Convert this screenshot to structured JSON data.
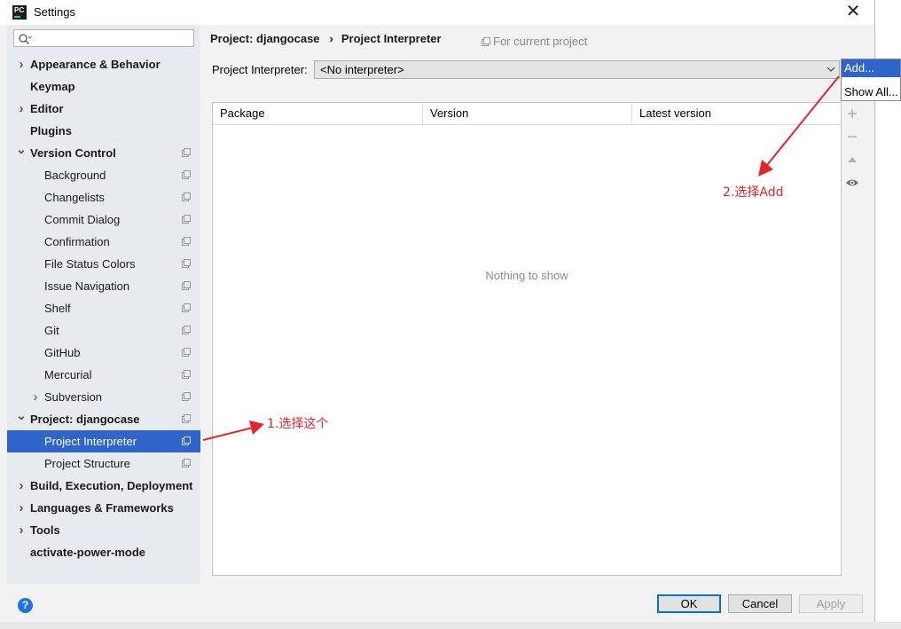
{
  "window": {
    "title": "Settings",
    "logo_text": "PC"
  },
  "search": {
    "placeholder": ""
  },
  "sidebar": {
    "items": [
      {
        "label": "Appearance & Behavior",
        "bold": true,
        "chevron": "right",
        "indent": 0,
        "project_icon": false
      },
      {
        "label": "Keymap",
        "bold": true,
        "chevron": "none",
        "indent": 0,
        "project_icon": false
      },
      {
        "label": "Editor",
        "bold": true,
        "chevron": "right",
        "indent": 0,
        "project_icon": false
      },
      {
        "label": "Plugins",
        "bold": true,
        "chevron": "none",
        "indent": 0,
        "project_icon": false
      },
      {
        "label": "Version Control",
        "bold": true,
        "chevron": "down",
        "indent": 0,
        "project_icon": true
      },
      {
        "label": "Background",
        "bold": false,
        "chevron": "none",
        "indent": 1,
        "project_icon": true
      },
      {
        "label": "Changelists",
        "bold": false,
        "chevron": "none",
        "indent": 1,
        "project_icon": true
      },
      {
        "label": "Commit Dialog",
        "bold": false,
        "chevron": "none",
        "indent": 1,
        "project_icon": true
      },
      {
        "label": "Confirmation",
        "bold": false,
        "chevron": "none",
        "indent": 1,
        "project_icon": true
      },
      {
        "label": "File Status Colors",
        "bold": false,
        "chevron": "none",
        "indent": 1,
        "project_icon": true
      },
      {
        "label": "Issue Navigation",
        "bold": false,
        "chevron": "none",
        "indent": 1,
        "project_icon": true
      },
      {
        "label": "Shelf",
        "bold": false,
        "chevron": "none",
        "indent": 1,
        "project_icon": true
      },
      {
        "label": "Git",
        "bold": false,
        "chevron": "none",
        "indent": 1,
        "project_icon": true
      },
      {
        "label": "GitHub",
        "bold": false,
        "chevron": "none",
        "indent": 1,
        "project_icon": true
      },
      {
        "label": "Mercurial",
        "bold": false,
        "chevron": "none",
        "indent": 1,
        "project_icon": true
      },
      {
        "label": "Subversion",
        "bold": false,
        "chevron": "right",
        "indent": 1,
        "project_icon": true
      },
      {
        "label": "Project: djangocase",
        "bold": true,
        "chevron": "down",
        "indent": 0,
        "project_icon": true
      },
      {
        "label": "Project Interpreter",
        "bold": false,
        "chevron": "none",
        "indent": 1,
        "project_icon": true,
        "selected": true
      },
      {
        "label": "Project Structure",
        "bold": false,
        "chevron": "none",
        "indent": 1,
        "project_icon": true
      },
      {
        "label": "Build, Execution, Deployment",
        "bold": true,
        "chevron": "right",
        "indent": 0,
        "project_icon": false
      },
      {
        "label": "Languages & Frameworks",
        "bold": true,
        "chevron": "right",
        "indent": 0,
        "project_icon": false
      },
      {
        "label": "Tools",
        "bold": true,
        "chevron": "right",
        "indent": 0,
        "project_icon": false
      },
      {
        "label": "activate-power-mode",
        "bold": true,
        "chevron": "none",
        "indent": 0,
        "project_icon": false
      }
    ]
  },
  "breadcrumb": {
    "project": "Project: djangocase",
    "separator": "›",
    "page": "Project Interpreter"
  },
  "for_current_project": "For current project",
  "interpreter": {
    "label": "Project Interpreter:",
    "value": "<No interpreter>"
  },
  "dropdown": {
    "items": [
      "Add...",
      "Show All..."
    ],
    "active_index": 0
  },
  "table": {
    "columns": [
      "Package",
      "Version",
      "Latest version"
    ],
    "rows": [],
    "empty_text": "Nothing to show"
  },
  "tools": [
    "add-icon",
    "remove-icon",
    "upgrade-icon",
    "eye-icon"
  ],
  "buttons": {
    "ok": "OK",
    "cancel": "Cancel",
    "apply": "Apply"
  },
  "help": "?",
  "annotations": {
    "step1": "1.选择这个",
    "step2": "2.选择Add",
    "color": "#e8242a"
  }
}
